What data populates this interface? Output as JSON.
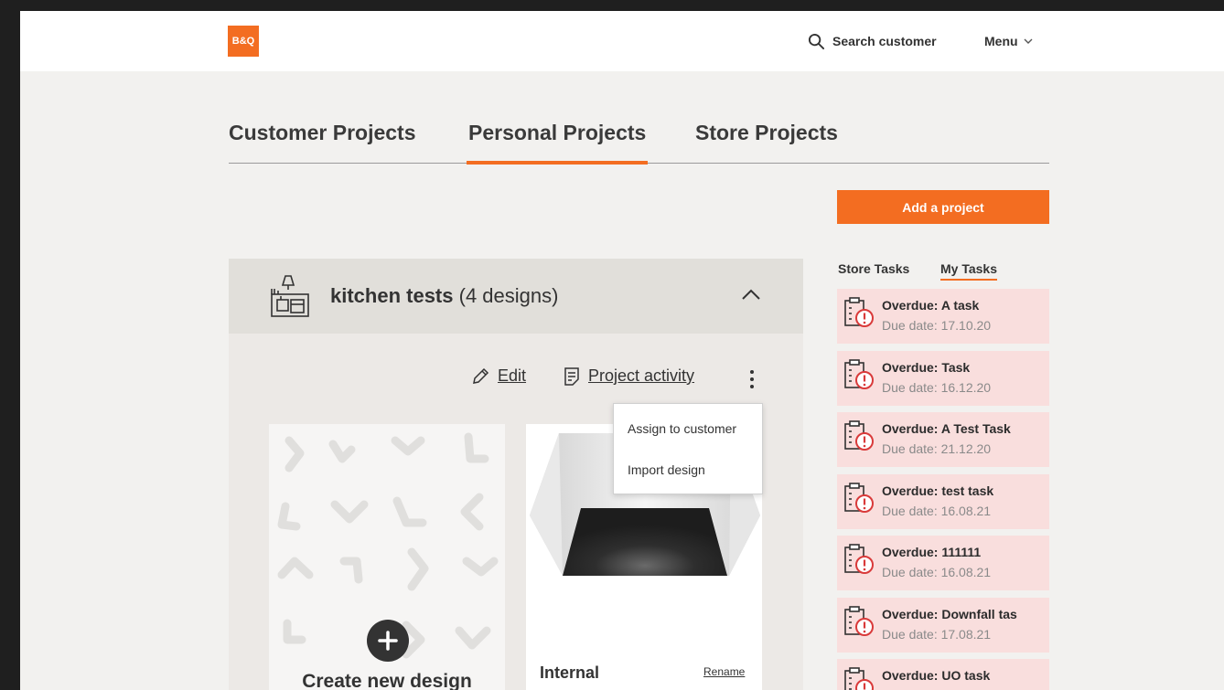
{
  "header": {
    "logo_text": "B&Q",
    "search_label": "Search customer",
    "menu_label": "Menu"
  },
  "tabs": [
    {
      "label": "Customer Projects",
      "active": false
    },
    {
      "label": "Personal Projects",
      "active": true
    },
    {
      "label": "Store Projects",
      "active": false
    }
  ],
  "add_project_label": "Add a project",
  "project": {
    "name": "kitchen tests",
    "count": "(4 designs)",
    "edit_label": "Edit",
    "activity_label": "Project activity",
    "create_label": "Create new design",
    "design_name": "Internal",
    "rename_label": "Rename"
  },
  "dropdown": {
    "items": [
      "Assign to customer",
      "Import design"
    ]
  },
  "task_tabs": [
    {
      "label": "Store Tasks",
      "active": false
    },
    {
      "label": "My Tasks",
      "active": true
    }
  ],
  "tasks": [
    {
      "title": "Overdue: A task",
      "due": "Due date: 17.10.20"
    },
    {
      "title": "Overdue: Task",
      "due": "Due date: 16.12.20"
    },
    {
      "title": "Overdue: A Test Task",
      "due": "Due date: 21.12.20"
    },
    {
      "title": "Overdue: test task",
      "due": "Due date: 16.08.21"
    },
    {
      "title": "Overdue: 111111",
      "due": "Due date: 16.08.21"
    },
    {
      "title": "Overdue: Downfall tas",
      "due": "Due date: 17.08.21"
    },
    {
      "title": "Overdue: UO task",
      "due": ""
    }
  ],
  "colors": {
    "brand_orange": "#f36d21",
    "overdue_bg": "#f9dedd",
    "overdue_icon": "#d93a3a"
  }
}
